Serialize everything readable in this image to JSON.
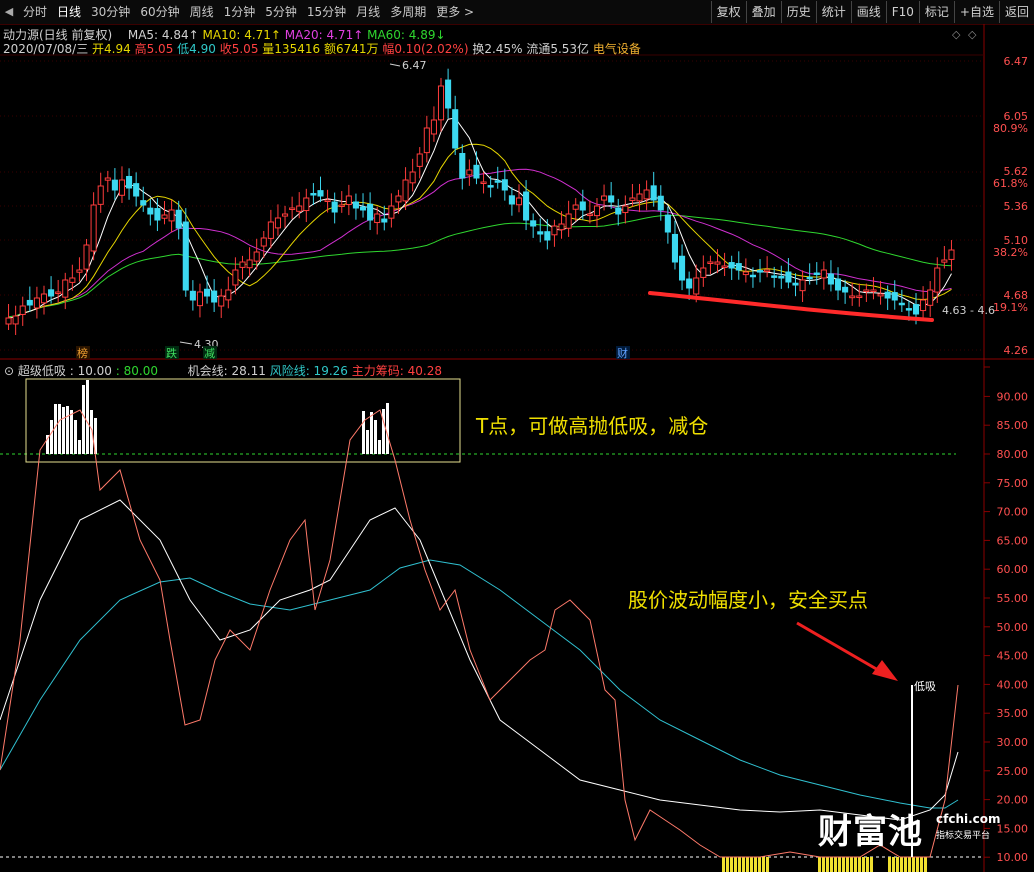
{
  "toolbar": {
    "tabs": [
      "分时",
      "日线",
      "30分钟",
      "60分钟",
      "周线",
      "1分钟",
      "5分钟",
      "15分钟",
      "月线",
      "多周期",
      "更多 >"
    ],
    "active_tab": "日线",
    "right_buttons": [
      "复权",
      "叠加",
      "历史",
      "统计",
      "画线",
      "F10",
      "标记",
      "+自选",
      "返回"
    ]
  },
  "header": {
    "stock_title": "动力源(日线 前复权)",
    "ma5": "MA5: 4.84↑",
    "ma10": "MA10: 4.71↑",
    "ma20": "MA20: 4.71↑",
    "ma60": "MA60: 4.89↓",
    "date": "2020/07/08/三",
    "open": "开4.94",
    "high": "高5.05",
    "low": "低4.90",
    "close": "收5.05",
    "volume": "量135416",
    "amount": "额6741万",
    "change": "幅0.10(2.02%)",
    "turnover": "换2.45%",
    "float": "流通5.53亿",
    "sector": "电气设备"
  },
  "price_axis": {
    "labels": [
      "6.47",
      "6.05",
      "80.9%",
      "5.62",
      "61.8%",
      "5.36",
      "5.10",
      "38.2%",
      "4.68",
      "19.1%",
      "4.26"
    ]
  },
  "price_annotations": {
    "high_mark": "6.47",
    "low_mark": "4.30",
    "range_mark": "4.63 - 4.6",
    "event_labels": [
      "榜",
      "跌",
      "减",
      "财"
    ]
  },
  "indicator": {
    "name": "超级低吸",
    "p1": ": 10.00",
    "p2": ": 80.00",
    "line_opportunity": "机会线: 28.11",
    "line_risk": "风险线: 19.26",
    "line_main": "主力筹码: 40.28",
    "axis_labels": [
      "90.00",
      "85.00",
      "80.00",
      "75.00",
      "70.00",
      "65.00",
      "60.00",
      "55.00",
      "50.00",
      "45.00",
      "40.00",
      "35.00",
      "30.00",
      "25.00",
      "20.00",
      "15.00",
      "10.00"
    ],
    "buy_label": "低吸"
  },
  "annotations": {
    "t_point": "T点，可做高抛低吸，减仓",
    "safe_buy": "股价波动幅度小，安全买点"
  },
  "watermark": {
    "brand": "财富池",
    "site": "cfchi.com",
    "tagline": "指标交易平台"
  },
  "colors": {
    "up": "#ff3c3c",
    "down": "#3cd8f0",
    "ma5": "#ffffff",
    "ma10": "#e6d600",
    "ma20": "#d030d0",
    "ma60": "#2fd62f",
    "annotation": "#f0e000"
  }
}
